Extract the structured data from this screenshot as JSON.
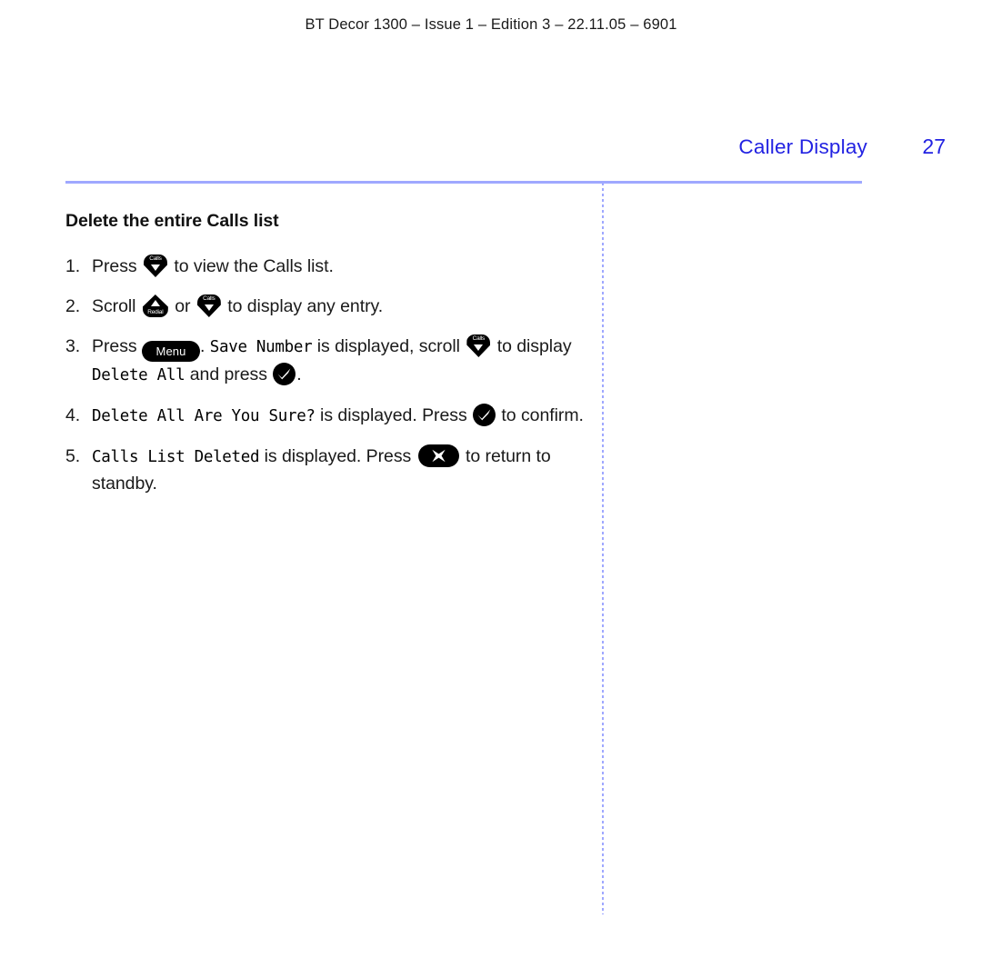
{
  "header": {
    "running_text": "BT Decor 1300 – Issue 1 – Edition 3 – 22.11.05 – 6901"
  },
  "chapter": {
    "title": "Caller Display",
    "page_number": "27",
    "accent_color": "#2222e2",
    "rule_color": "#9fa8ff"
  },
  "section": {
    "heading": "Delete the entire Calls list"
  },
  "icons": {
    "calls_label": "Calls",
    "redial_label": "Redial",
    "menu_label": "Menu"
  },
  "steps": [
    {
      "marker": "1.",
      "p1": "Press",
      "p2": "to view the Calls list."
    },
    {
      "marker": "2.",
      "p1": "Scroll",
      "p2": "or",
      "p3": "to display any entry."
    },
    {
      "marker": "3.",
      "p1": "Press",
      "p2": ".",
      "lcd1": "Save Number",
      "p3": "is displayed, scroll",
      "p4": "to display",
      "lcd2": "Delete All",
      "p5": "and press",
      "p6": "."
    },
    {
      "marker": "4.",
      "lcd1": "Delete All Are You Sure?",
      "p1": "is displayed. Press",
      "p2": "to confirm."
    },
    {
      "marker": "5.",
      "lcd1": "Calls List Deleted",
      "p1": "is displayed. Press",
      "p2": "to return to standby."
    }
  ]
}
